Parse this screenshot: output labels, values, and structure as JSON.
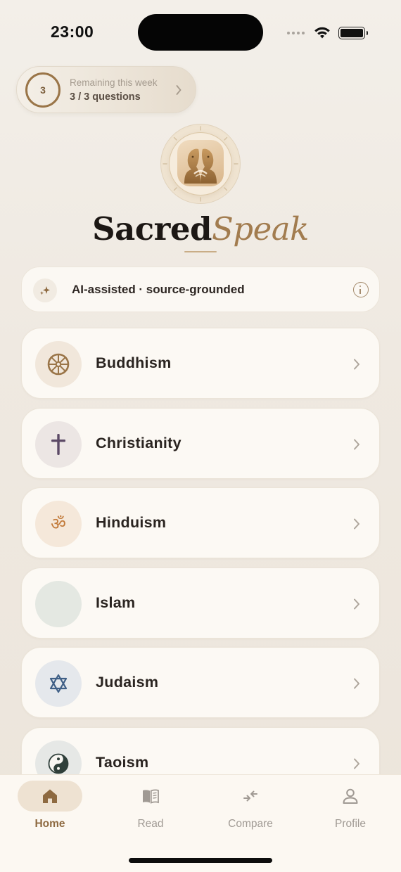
{
  "status_bar": {
    "time": "23:00"
  },
  "quota": {
    "count": "3",
    "title": "Remaining this week",
    "value": "3 / 3 questions"
  },
  "brand": {
    "part1": "Sacred",
    "part2": "Speak"
  },
  "notice": {
    "text": "AI-assisted · source-grounded"
  },
  "religions": [
    {
      "name": "Buddhism",
      "icon": "dharma-wheel-icon",
      "color": "#9a7548"
    },
    {
      "name": "Christianity",
      "icon": "cross-icon",
      "color": "#5c4a66"
    },
    {
      "name": "Hinduism",
      "icon": "om-icon",
      "color": "#c27a3a"
    },
    {
      "name": "Islam",
      "icon": "crescent-icon",
      "color": "#3f6452"
    },
    {
      "name": "Judaism",
      "icon": "star-of-david-icon",
      "color": "#3f5f86"
    },
    {
      "name": "Taoism",
      "icon": "yin-yang-icon",
      "color": "#2f3f3a"
    }
  ],
  "tabs": [
    {
      "label": "Home",
      "icon": "home-icon",
      "active": true
    },
    {
      "label": "Read",
      "icon": "book-icon",
      "active": false
    },
    {
      "label": "Compare",
      "icon": "compare-arrows-icon",
      "active": false
    },
    {
      "label": "Profile",
      "icon": "person-icon",
      "active": false
    }
  ],
  "colors": {
    "accent": "#9a7548",
    "background": "#f1ece4",
    "card": "#fcf9f4"
  }
}
